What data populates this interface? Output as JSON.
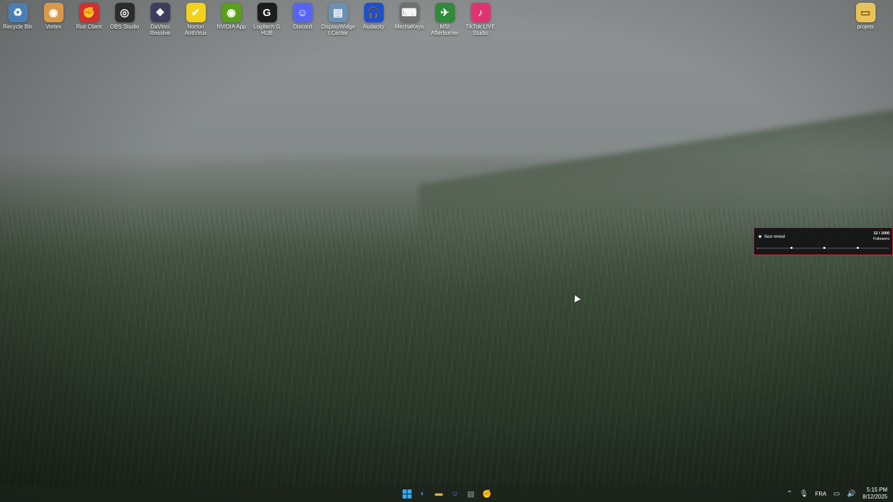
{
  "desktop_icons": [
    {
      "label": "Recycle Bin",
      "icon": "recycle-bin-icon",
      "glyph": "♻",
      "color": "#4a7fb5"
    },
    {
      "label": "Vortex",
      "icon": "vortex-icon",
      "glyph": "◉",
      "color": "#d89a4a"
    },
    {
      "label": "Riot Client",
      "icon": "riot-client-icon",
      "glyph": "✊",
      "color": "#d32f2f"
    },
    {
      "label": "OBS Studio",
      "icon": "obs-studio-icon",
      "glyph": "◎",
      "color": "#2b2b2b"
    },
    {
      "label": "DaVinci Resolve",
      "icon": "davinci-resolve-icon",
      "glyph": "❖",
      "color": "#3b3f5c"
    },
    {
      "label": "Norton AntiVirus",
      "icon": "norton-antivirus-icon",
      "glyph": "✔",
      "color": "#f2d21a"
    },
    {
      "label": "NVIDIA App",
      "icon": "nvidia-app-icon",
      "glyph": "◉",
      "color": "#5a9e1b"
    },
    {
      "label": "Logitech G HUB",
      "icon": "logitech-g-hub-icon",
      "glyph": "G",
      "color": "#1c1c1c"
    },
    {
      "label": "Discord",
      "icon": "discord-icon",
      "glyph": "☺",
      "color": "#5865f2"
    },
    {
      "label": "DisplayWidget Center",
      "icon": "displaywidget-center-icon",
      "glyph": "▤",
      "color": "#6d8fb3"
    },
    {
      "label": "Audacity",
      "icon": "audacity-icon",
      "glyph": "🎧",
      "color": "#1d4fd1"
    },
    {
      "label": "MechaKeys",
      "icon": "mechakeys-icon",
      "glyph": "⌨",
      "color": "#707070"
    },
    {
      "label": "MSI Afterburner",
      "icon": "msi-afterburner-icon",
      "glyph": "✈",
      "color": "#2f8a3a"
    },
    {
      "label": "TikTok LIVE Studio",
      "icon": "tiktok-live-studio-icon",
      "glyph": "♪",
      "color": "#e0336f"
    }
  ],
  "right_icon": {
    "label": "projets",
    "icon": "folder-icon",
    "glyph": "▭",
    "color": "#e8c35a"
  },
  "widget": {
    "goal_label": "face reveal",
    "count": "12 / 1000",
    "unit": "Followers",
    "progress_fraction": 0.012
  },
  "taskbar": {
    "apps": [
      {
        "name": "start-button",
        "icon": "windows-icon"
      },
      {
        "name": "taskbar-chrome",
        "icon": "chrome-icon",
        "glyph": "◐",
        "color": "#3a8ad8"
      },
      {
        "name": "taskbar-file-explorer",
        "icon": "folder-icon",
        "glyph": "▬",
        "color": "#e8b93a"
      },
      {
        "name": "taskbar-discord",
        "icon": "discord-icon",
        "glyph": "☺",
        "color": "#5865f2"
      },
      {
        "name": "taskbar-notepad",
        "icon": "notepad-icon",
        "glyph": "▤",
        "color": "#9aa9b8"
      },
      {
        "name": "taskbar-riot-client",
        "icon": "riot-client-icon",
        "glyph": "✊",
        "color": "#d32f2f"
      }
    ],
    "language": "FRA",
    "time": "5:15 PM",
    "date": "8/12/2025"
  }
}
